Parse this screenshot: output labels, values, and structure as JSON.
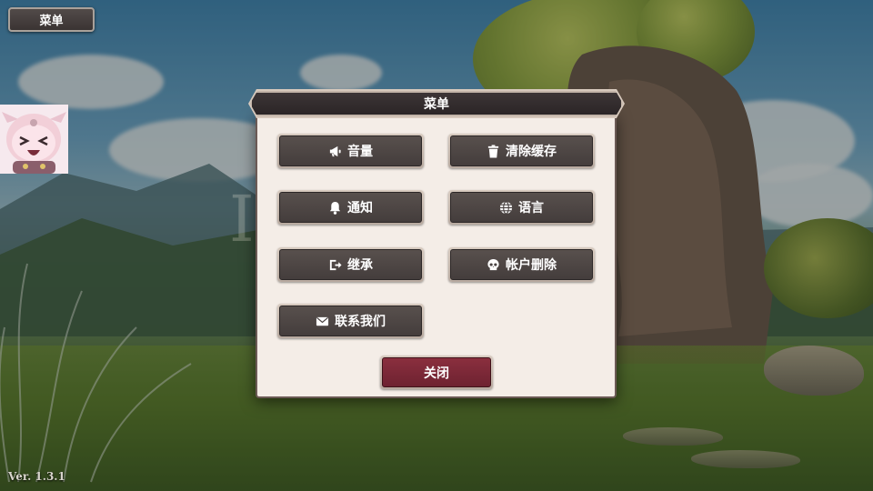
{
  "top_menu": {
    "label": "菜单"
  },
  "dialog": {
    "title": "菜单",
    "options": [
      {
        "key": "volume",
        "label": "音量",
        "icon": "megaphone-icon"
      },
      {
        "key": "clear-cache",
        "label": "清除缓存",
        "icon": "trash-icon"
      },
      {
        "key": "notification",
        "label": "通知",
        "icon": "bell-icon"
      },
      {
        "key": "language",
        "label": "语言",
        "icon": "globe-icon"
      },
      {
        "key": "inherit",
        "label": "继承",
        "icon": "export-icon"
      },
      {
        "key": "delete-account",
        "label": "帐户删除",
        "icon": "skull-icon"
      },
      {
        "key": "contact-us",
        "label": "联系我们",
        "icon": "mail-icon"
      }
    ],
    "close_label": "关闭"
  },
  "version": "Ver. 1.3.1",
  "colors": {
    "button_dark": "#4e4645",
    "close_red": "#7e2838",
    "dialog_bg": "#f4ede7"
  }
}
